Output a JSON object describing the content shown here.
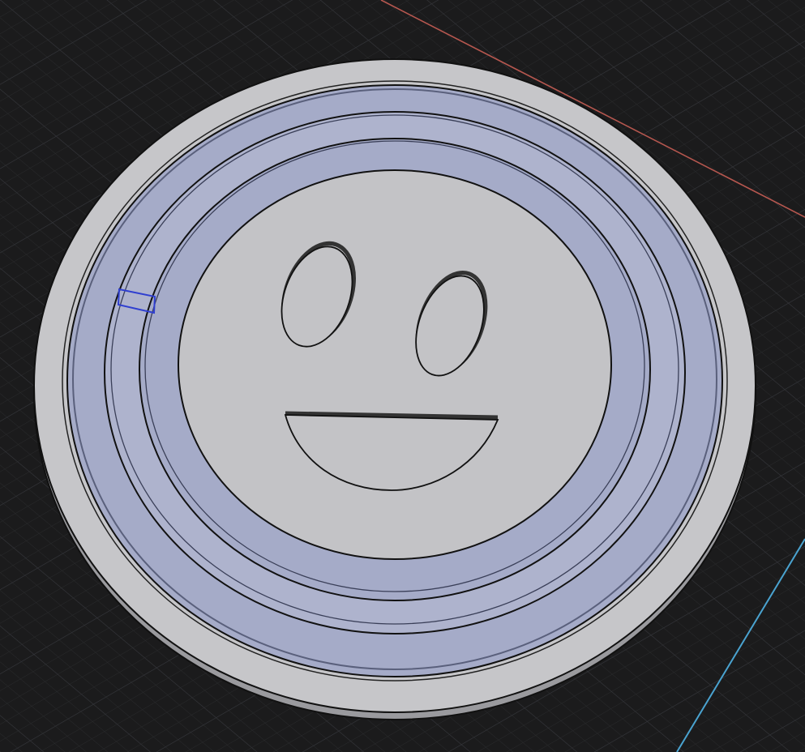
{
  "viewport": {
    "type": "3d-model-viewport",
    "background_color": "#1b1b1c",
    "grid_color": "#3a3b3e",
    "x_axis_color": "#b6574f",
    "y_axis_color": "#4aa3d0"
  },
  "model": {
    "description_icon": "smiley-face-coin",
    "base_color": "#c3c3c6",
    "selected_face_color": "#a5abc8",
    "highlight_color": "#2f3fd0",
    "features": [
      "outer-rim",
      "selected-channel",
      "inner-ring",
      "face-disc",
      "left-eye",
      "right-eye",
      "mouth"
    ]
  }
}
